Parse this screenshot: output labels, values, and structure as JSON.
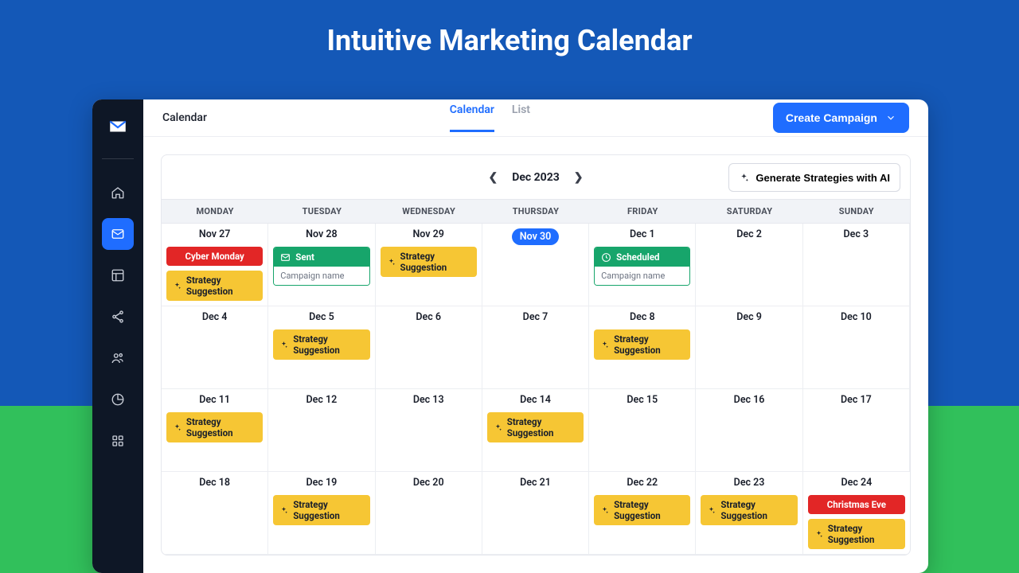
{
  "hero": {
    "title": "Intuitive Marketing Calendar"
  },
  "breadcrumb": "Calendar",
  "tabs": {
    "calendar": "Calendar",
    "list": "List"
  },
  "create_button": "Create Campaign",
  "month_label": "Dec 2023",
  "generate_button": "Generate Strategies with AI",
  "dow": [
    "MONDAY",
    "TUESDAY",
    "WEDNESDAY",
    "THURSDAY",
    "FRIDAY",
    "SATURDAY",
    "SUNDAY"
  ],
  "labels": {
    "strategy_suggestion": "Strategy Suggestion",
    "sent": "Sent",
    "scheduled": "Scheduled",
    "campaign_name": "Campaign name",
    "cyber_monday": "Cyber Monday",
    "christmas_eve": "Christmas Eve"
  },
  "cells": [
    {
      "date": "Nov 27",
      "items": [
        {
          "type": "red",
          "key": "cyber_monday"
        },
        {
          "type": "amber",
          "key": "strategy_suggestion"
        }
      ]
    },
    {
      "date": "Nov 28",
      "items": [
        {
          "type": "card",
          "title_key": "sent",
          "body_key": "campaign_name",
          "icon": "mail"
        }
      ]
    },
    {
      "date": "Nov 29",
      "items": [
        {
          "type": "amber",
          "key": "strategy_suggestion"
        }
      ]
    },
    {
      "date": "Nov 30",
      "today": true,
      "items": []
    },
    {
      "date": "Dec 1",
      "items": [
        {
          "type": "card",
          "title_key": "scheduled",
          "body_key": "campaign_name",
          "icon": "clock"
        }
      ]
    },
    {
      "date": "Dec 2",
      "items": []
    },
    {
      "date": "Dec 3",
      "items": []
    },
    {
      "date": "Dec 4",
      "items": []
    },
    {
      "date": "Dec 5",
      "items": [
        {
          "type": "amber",
          "key": "strategy_suggestion"
        }
      ]
    },
    {
      "date": "Dec 6",
      "items": []
    },
    {
      "date": "Dec 7",
      "items": []
    },
    {
      "date": "Dec 8",
      "items": [
        {
          "type": "amber",
          "key": "strategy_suggestion"
        }
      ]
    },
    {
      "date": "Dec 9",
      "items": []
    },
    {
      "date": "Dec 10",
      "items": []
    },
    {
      "date": "Dec 11",
      "items": [
        {
          "type": "amber",
          "key": "strategy_suggestion"
        }
      ]
    },
    {
      "date": "Dec 12",
      "items": []
    },
    {
      "date": "Dec 13",
      "items": []
    },
    {
      "date": "Dec 14",
      "items": [
        {
          "type": "amber",
          "key": "strategy_suggestion"
        }
      ]
    },
    {
      "date": "Dec 15",
      "items": []
    },
    {
      "date": "Dec 16",
      "items": []
    },
    {
      "date": "Dec 17",
      "items": []
    },
    {
      "date": "Dec 18",
      "items": []
    },
    {
      "date": "Dec 19",
      "items": [
        {
          "type": "amber",
          "key": "strategy_suggestion"
        }
      ]
    },
    {
      "date": "Dec 20",
      "items": []
    },
    {
      "date": "Dec 21",
      "items": []
    },
    {
      "date": "Dec 22",
      "items": [
        {
          "type": "amber",
          "key": "strategy_suggestion"
        }
      ]
    },
    {
      "date": "Dec 23",
      "items": [
        {
          "type": "amber",
          "key": "strategy_suggestion"
        }
      ]
    },
    {
      "date": "Dec 24",
      "items": [
        {
          "type": "red",
          "key": "christmas_eve"
        },
        {
          "type": "amber",
          "key": "strategy_suggestion"
        }
      ]
    }
  ]
}
